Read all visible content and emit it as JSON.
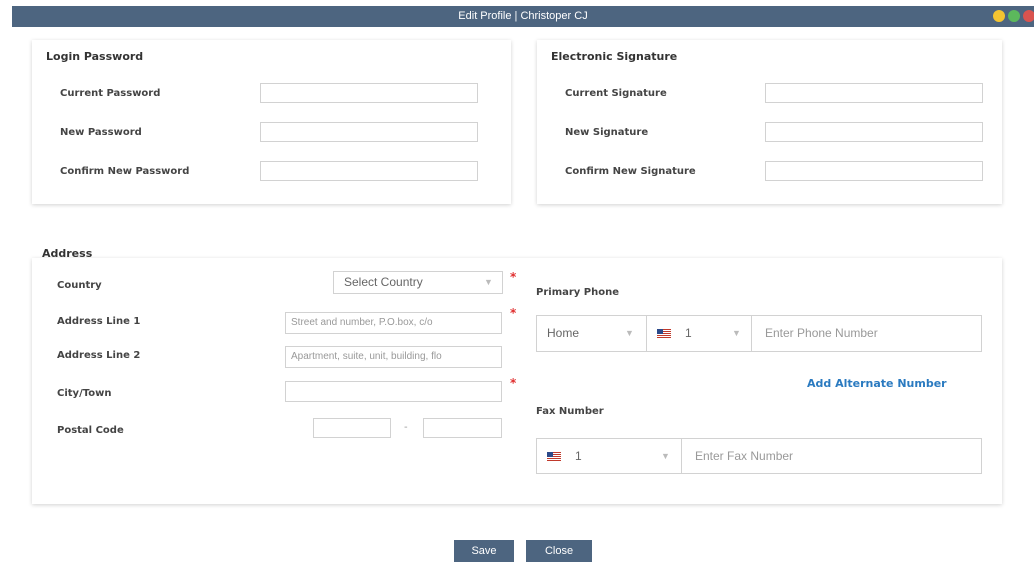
{
  "window": {
    "title": "Edit Profile | Christoper CJ"
  },
  "login_password": {
    "title": "Login Password",
    "current_label": "Current Password",
    "new_label": "New Password",
    "confirm_label": "Confirm New Password"
  },
  "signature": {
    "title": "Electronic Signature",
    "current_label": "Current Signature",
    "new_label": "New Signature",
    "confirm_label": "Confirm New Signature"
  },
  "address": {
    "title": "Address",
    "country_label": "Country",
    "country_value": "Select Country",
    "line1_label": "Address Line 1",
    "line1_placeholder": "Street and number, P.O.box, c/o",
    "line2_label": "Address Line 2",
    "line2_placeholder": "Apartment, suite, unit, building, flo",
    "city_label": "City/Town",
    "postal_label": "Postal Code",
    "postal_sep": "-",
    "required_mark": "*"
  },
  "phone": {
    "primary_label": "Primary Phone",
    "type_value": "Home",
    "country_code": "1",
    "placeholder": "Enter Phone Number",
    "add_alternate": "Add Alternate Number"
  },
  "fax": {
    "label": "Fax Number",
    "country_code": "1",
    "placeholder": "Enter Fax Number"
  },
  "actions": {
    "save": "Save",
    "close": "Close"
  },
  "icons": {
    "dropdown": "chevron-down-icon",
    "flag": "us-flag-icon"
  }
}
